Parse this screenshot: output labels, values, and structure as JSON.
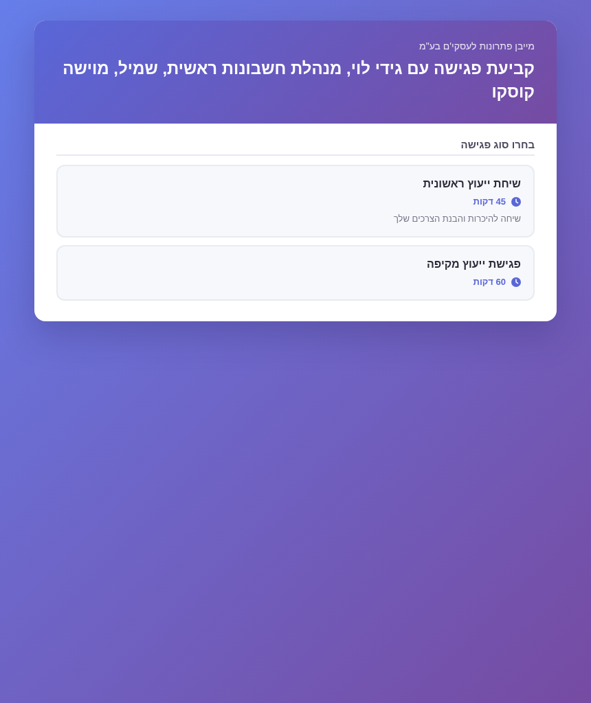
{
  "header": {
    "subtitle": "מייבן פתרונות לעסקי'ם בע\"מ",
    "title": "קביעת פגישה עם גידי לוי, מנהלת חשבונות ראשית, שמיל, מוישה קוסקו"
  },
  "section": {
    "label": "בחרו סוג פגישה"
  },
  "meeting_types": [
    {
      "name": "שיחת ייעוץ ראשונית",
      "duration": "45 דקות",
      "description": "שיחה להיכרות והבנת הצרכים שלך"
    },
    {
      "name": "פגישת ייעוץ מקיפה",
      "duration": "60 דקות"
    }
  ]
}
